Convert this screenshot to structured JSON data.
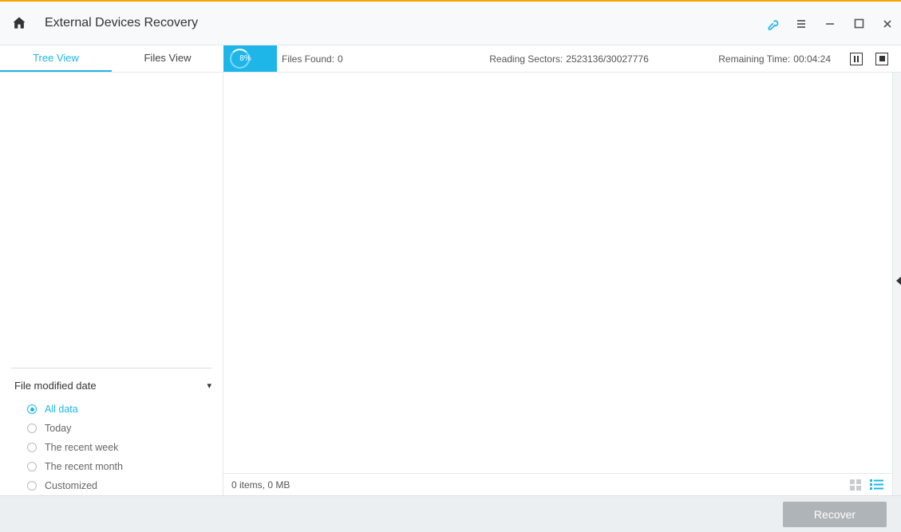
{
  "title": "External Devices Recovery",
  "tabs": {
    "tree": "Tree View",
    "files": "Files View",
    "active": "tree"
  },
  "scan": {
    "progress_pct": "8%",
    "files_found_label": "Files Found:",
    "files_found_value": "0",
    "reading_sectors_label": "Reading Sectors:",
    "reading_sectors_value": "2523136/30027776",
    "remaining_time_label": "Remaining Time:",
    "remaining_time_value": "00:04:24"
  },
  "filter": {
    "heading": "File modified date",
    "options": [
      "All data",
      "Today",
      "The recent week",
      "The recent month",
      "Customized"
    ],
    "selected": 0
  },
  "status": {
    "summary": "0 items, 0 MB"
  },
  "footer": {
    "recover": "Recover"
  }
}
